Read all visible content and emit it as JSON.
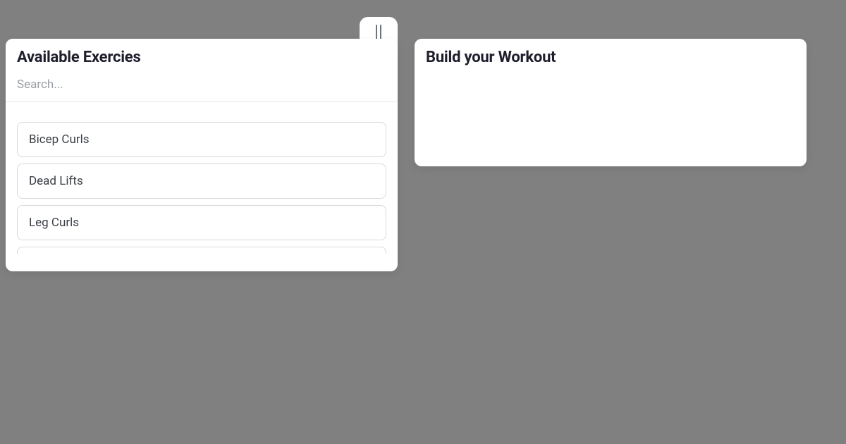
{
  "handle": {
    "name": "drag-handle"
  },
  "left_panel": {
    "title": "Available Exercies",
    "search_placeholder": "Search...",
    "items": [
      {
        "label": "Bicep Curls"
      },
      {
        "label": "Dead Lifts"
      },
      {
        "label": "Leg Curls"
      }
    ]
  },
  "right_panel": {
    "title": "Build your Workout"
  }
}
